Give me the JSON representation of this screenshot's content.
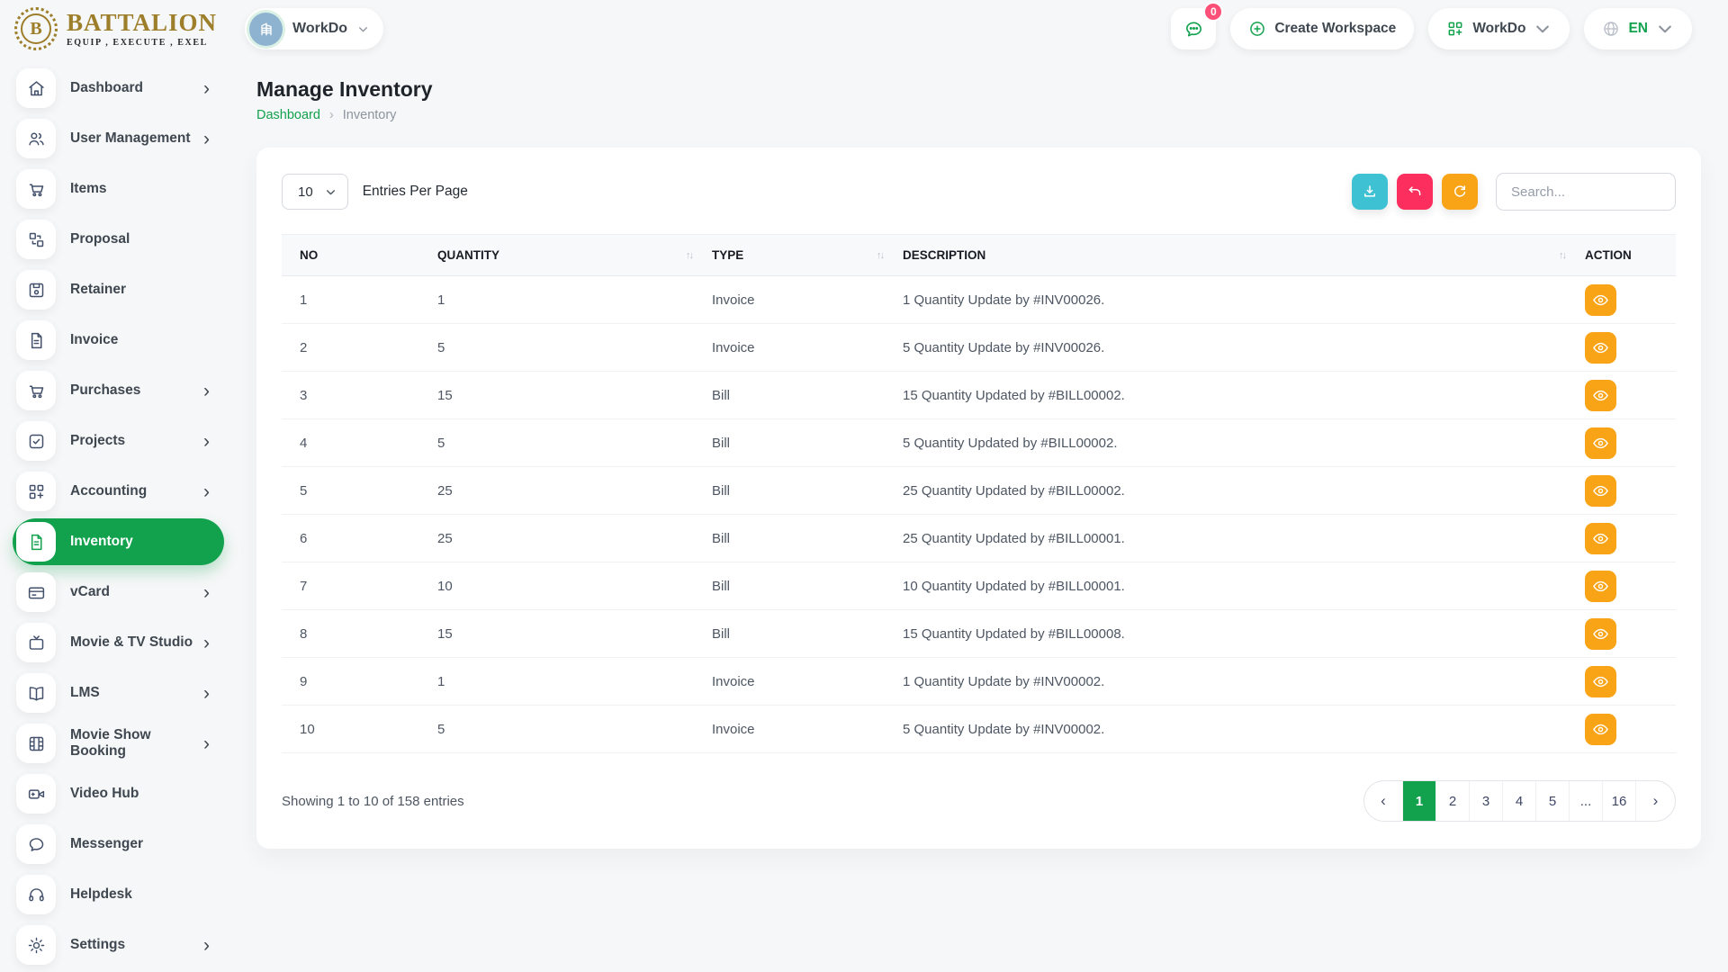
{
  "brand": {
    "name": "BATTALION",
    "tagline": "EQUIP , EXECUTE , EXEL",
    "monogram": "B"
  },
  "topbar": {
    "workspace_switcher": {
      "label": "WorkDo",
      "icon": "building-icon"
    },
    "messages": {
      "badge": "0",
      "icon": "chat-bubble-icon"
    },
    "create_workspace": {
      "label": "Create Workspace",
      "icon": "plus-circle-icon"
    },
    "workdo_menu": {
      "label": "WorkDo",
      "icon": "grid-plus-icon"
    },
    "language": {
      "label": "EN",
      "icon": "globe-icon"
    }
  },
  "sidebar": {
    "items": [
      {
        "label": "Dashboard",
        "icon": "home-icon",
        "chevron": true,
        "active": false
      },
      {
        "label": "User Management",
        "icon": "users-icon",
        "chevron": true,
        "active": false
      },
      {
        "label": "Items",
        "icon": "cart-icon",
        "chevron": false,
        "active": false
      },
      {
        "label": "Proposal",
        "icon": "swap-boxes-icon",
        "chevron": false,
        "active": false
      },
      {
        "label": "Retainer",
        "icon": "floppy-icon",
        "chevron": false,
        "active": false
      },
      {
        "label": "Invoice",
        "icon": "file-icon",
        "chevron": false,
        "active": false
      },
      {
        "label": "Purchases",
        "icon": "cart-icon",
        "chevron": true,
        "active": false
      },
      {
        "label": "Projects",
        "icon": "check-square-icon",
        "chevron": true,
        "active": false
      },
      {
        "label": "Accounting",
        "icon": "grid-plus-icon",
        "chevron": true,
        "active": false
      },
      {
        "label": "Inventory",
        "icon": "document-icon",
        "chevron": false,
        "active": true
      },
      {
        "label": "vCard",
        "icon": "credit-card-icon",
        "chevron": true,
        "active": false
      },
      {
        "label": "Movie & TV Studio",
        "icon": "tv-icon",
        "chevron": true,
        "active": false
      },
      {
        "label": "LMS",
        "icon": "book-icon",
        "chevron": true,
        "active": false
      },
      {
        "label": "Movie Show Booking",
        "icon": "film-icon",
        "chevron": true,
        "active": false
      },
      {
        "label": "Video Hub",
        "icon": "video-camera-icon",
        "chevron": false,
        "active": false
      },
      {
        "label": "Messenger",
        "icon": "chat-bubble-icon",
        "chevron": false,
        "active": false
      },
      {
        "label": "Helpdesk",
        "icon": "headset-icon",
        "chevron": false,
        "active": false
      },
      {
        "label": "Settings",
        "icon": "gear-icon",
        "chevron": true,
        "active": false
      }
    ]
  },
  "page": {
    "title": "Manage Inventory",
    "breadcrumb": {
      "home": "Dashboard",
      "separator": "›",
      "current": "Inventory"
    }
  },
  "toolbar": {
    "entries_per_page_value": "10",
    "entries_per_page_label": "Entries Per Page",
    "search_placeholder": "Search...",
    "buttons": [
      {
        "name": "download-button",
        "icon": "download-icon",
        "color": "#3ec1d3"
      },
      {
        "name": "undo-button",
        "icon": "undo-icon",
        "color": "#fb2e5d"
      },
      {
        "name": "refresh-button",
        "icon": "refresh-icon",
        "color": "#f9a416"
      }
    ]
  },
  "table": {
    "columns": [
      {
        "label": "NO",
        "sortable": false
      },
      {
        "label": "QUANTITY",
        "sortable": true
      },
      {
        "label": "TYPE",
        "sortable": true
      },
      {
        "label": "DESCRIPTION",
        "sortable": true
      },
      {
        "label": "ACTION",
        "sortable": false
      }
    ],
    "action_icon": "eye-icon",
    "rows": [
      {
        "no": "1",
        "quantity": "1",
        "type": "Invoice",
        "description": "1 Quantity Update by #INV00026."
      },
      {
        "no": "2",
        "quantity": "5",
        "type": "Invoice",
        "description": "5 Quantity Update by #INV00026."
      },
      {
        "no": "3",
        "quantity": "15",
        "type": "Bill",
        "description": "15 Quantity Updated by #BILL00002."
      },
      {
        "no": "4",
        "quantity": "5",
        "type": "Bill",
        "description": "5 Quantity Updated by #BILL00002."
      },
      {
        "no": "5",
        "quantity": "25",
        "type": "Bill",
        "description": "25 Quantity Updated by #BILL00002."
      },
      {
        "no": "6",
        "quantity": "25",
        "type": "Bill",
        "description": "25 Quantity Updated by #BILL00001."
      },
      {
        "no": "7",
        "quantity": "10",
        "type": "Bill",
        "description": "10 Quantity Updated by #BILL00001."
      },
      {
        "no": "8",
        "quantity": "15",
        "type": "Bill",
        "description": "15 Quantity Updated by #BILL00008."
      },
      {
        "no": "9",
        "quantity": "1",
        "type": "Invoice",
        "description": "1 Quantity Update by #INV00002."
      },
      {
        "no": "10",
        "quantity": "5",
        "type": "Invoice",
        "description": "5 Quantity Update by #INV00002."
      }
    ]
  },
  "footer": {
    "summary": "Showing 1 to 10 of 158 entries",
    "pagination": {
      "prev": "‹",
      "pages": [
        "1",
        "2",
        "3",
        "4",
        "5",
        "...",
        "16"
      ],
      "active": "1",
      "next": "›"
    }
  },
  "glyphs": {
    "sort": "↑↓",
    "chevron_right": "›"
  },
  "colors": {
    "accent_green": "#12a24e",
    "download_teal": "#3ec1d3",
    "undo_pink": "#fb2e5d",
    "warning_orange": "#f9a416",
    "badge_pink": "#fc5078",
    "avatar_blue": "#8db3d1",
    "brand_gold": "#9d7e2a"
  }
}
